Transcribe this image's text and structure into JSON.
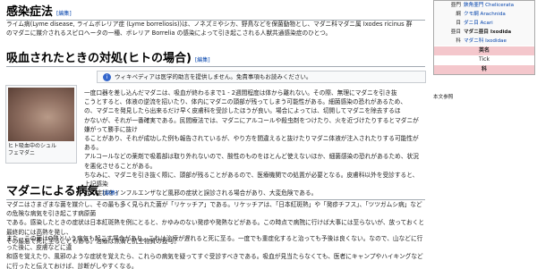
{
  "sections": [
    {
      "heading": "感染症法",
      "edit_label": "[編集]"
    },
    {
      "heading": "吸血されたときの対処(ヒトの場合)",
      "edit_label": "[編集]"
    },
    {
      "heading": "マダニによる病気",
      "edit_label": "[編集]"
    }
  ],
  "infection_para": [
    "ライム病(Lyme disease, ライムボレリア症 (Lyme borreliosis))は、ノネズミやシカ、野鳥などを保菌動物とし、マダニ科マダニ属 Ixodes ricinus 群",
    "のマダニに媒介されるスピロヘータの一種、ボレリア Borrelia の感染によって引き起こされる人獣共通感染症のひとつ。"
  ],
  "notice": {
    "text": "ウィキペディアは医学的助言を提供しません。免責事項もお読みください。"
  },
  "thumb": {
    "caption_lines": [
      "ヒト吸血中のシュル",
      "フェマダニ"
    ]
  },
  "bite_para": [
    "一度口器を差し込んだマダニは、吸血が終わるまで1 - 2週間程度は体から離れない。その際、無理にマダニを引き抜",
    "こうとすると、体液の逆流を招いたり、体内にマダニの頭部が残ってしまう可能性がある。細菌感染の恐れがあるため、",
    "の、マダニを発見したら出来るだけ早く皮膚科を受診したほうが良い。場合によっては、切開してマダニを除去するほ",
    "かないが、それが一番確実である。民間療法では、マダニにアルコールや殺虫剤をつけたり、火を近づけたりするとマダニが嫌がって勝手に抜け",
    "ることがあり、それが成功した例も報告されているが、やり方を間違えると抜けたりマダニ体液が注入されたりする可能性がある。",
    "アルコールなどの薬剤で吸着部は取り外れないので、酸性のものをほとんど使えないほか、細菌感染の恐れがあるため、状況を悪化させることがある。",
    "ちなみに、マダニを引き抜く際に、頭部が残ることがあるので、医療機関での処置が必要となる。皮膚科以外を受診すると、上記感染",
    "症の症状をインフルエンザなど風邪の症状と誤診される場合があり、大変危険である。"
  ],
  "disease_para_1": [
    "マダニはさまざまな菌を媒介し、その最も多く見られた菌が「リケッチア」である。リケッチアは、「日本紅斑熱」や「発疹チフス」、「ツツガムシ病」などの危険な病気を引き起こす病原菌",
    "である。感染したときの症状は日本紅斑熱を例にとると、かゆみのない発疹や発熱などがある。この時点で病院に行けば大事には至らないが、放っておくと最終的には高熱を発し、",
    "その最悪で死に至ることもある。治療は点滴と抗生物質の投与。"
  ],
  "disease_para_2": [
    "また、この菌はQ熱という病気も起こす場合があり、これは治療が遅れると死に至る。一度でも重症化すると治っても予後は良くない。なので、山などに行った後に、皮膚などに違",
    "和感を覚えたり、風邪のような症状を覚えたら、これらの病気を疑ってすぐ受診すべきである。吸血が見当たらなくても、医者にキャンプやハイキングなどに行ったと伝えておけば、診断がしやすくなる。"
  ],
  "taxobox": {
    "rows": [
      {
        "rank": "亜門",
        "name": "鋏角亜門 Chelicerata"
      },
      {
        "rank": "綱",
        "name": "クモ綱 Arachnida"
      },
      {
        "rank": "目",
        "name": "ダニ目 Acari"
      },
      {
        "rank": "亜目",
        "name": "マダニ亜目 Ixodida"
      },
      {
        "rank": "科",
        "name": "マダニ科 Ixodidae"
      }
    ],
    "english_header": "英名",
    "english_value": "Tick",
    "family_header": "科",
    "ref_label": "本文参照"
  }
}
